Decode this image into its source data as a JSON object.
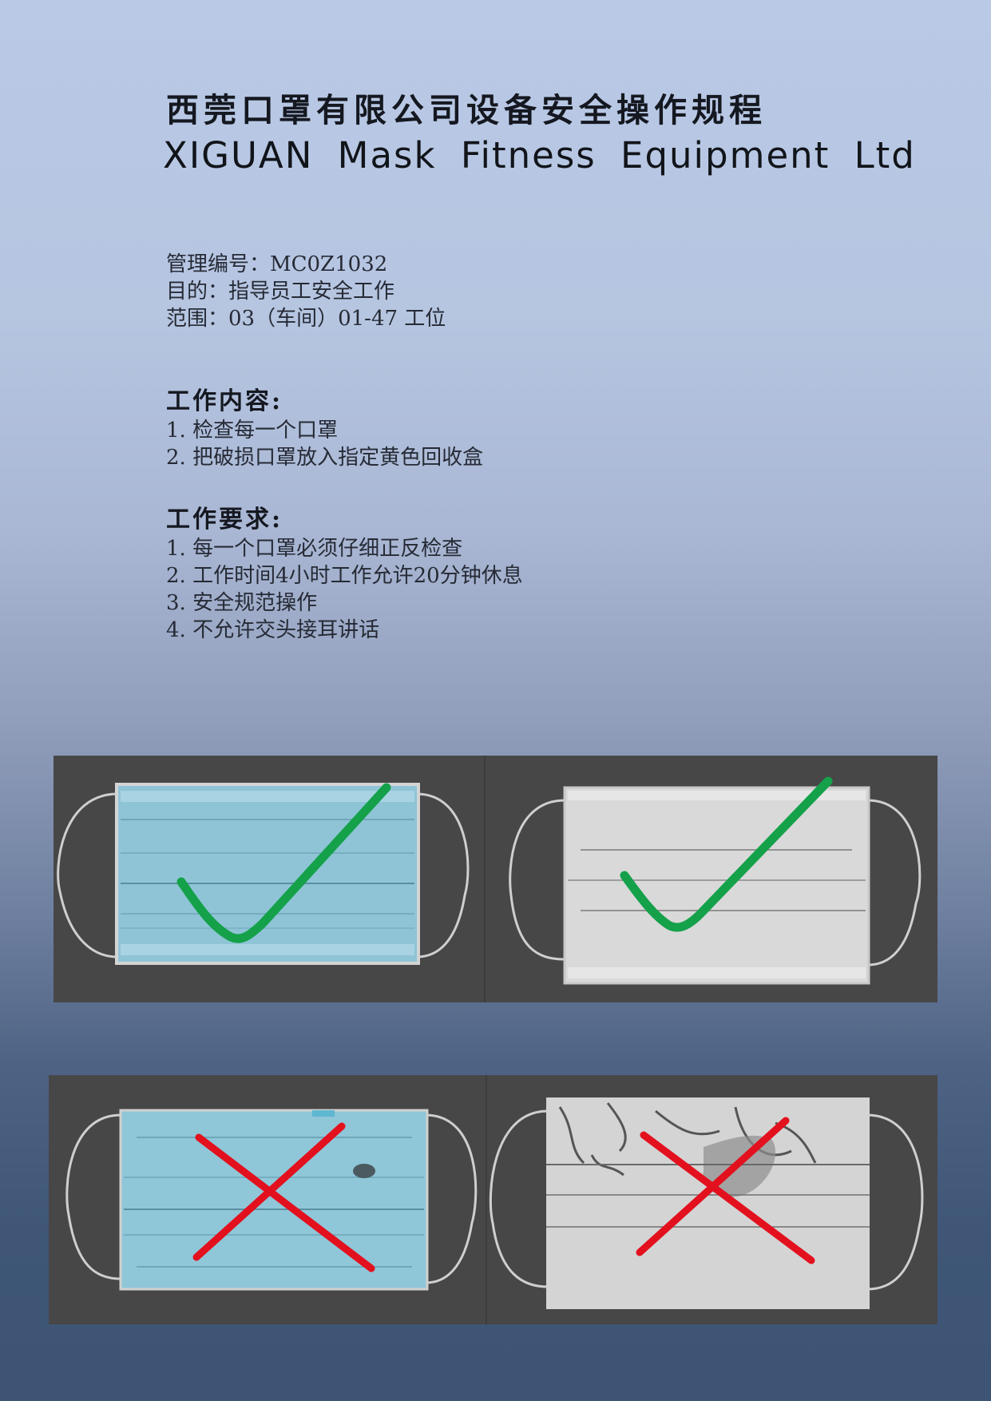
{
  "header": {
    "title_zh": "西莞口罩有限公司设备安全操作规程",
    "title_en": "XIGUAN Mask Fitness Equipment Ltd"
  },
  "meta": {
    "code_label": "管理编号：MC0Z1032",
    "purpose_label": "目的：指导员工安全工作",
    "scope_label": "范围：03（车间）01-47 工位"
  },
  "work_content": {
    "heading": "工作内容:",
    "items": [
      "1. 检查每一个口罩",
      "2. 把破损口罩放入指定黄色回收盒"
    ]
  },
  "work_requirements": {
    "heading": "工作要求:",
    "items": [
      "1. 每一个口罩必须仔细正反检查",
      "2. 工作时间4小时工作允许20分钟休息",
      "3. 安全规范操作",
      "4. 不允许交头接耳讲话"
    ]
  },
  "examples": {
    "good": [
      {
        "mask": "blue-mask",
        "mark": "check-mark-icon"
      },
      {
        "mask": "white-mask",
        "mark": "check-mark-icon"
      }
    ],
    "bad": [
      {
        "mask": "blue-mask-stained",
        "mark": "cross-mark-icon"
      },
      {
        "mask": "white-mask-dirty",
        "mark": "cross-mark-icon"
      }
    ]
  },
  "colors": {
    "check": "#14a14a",
    "cross": "#e3101e",
    "panel": "#474747",
    "blue_mask": "#8fc6d8",
    "white_mask": "#d6d6d6"
  }
}
